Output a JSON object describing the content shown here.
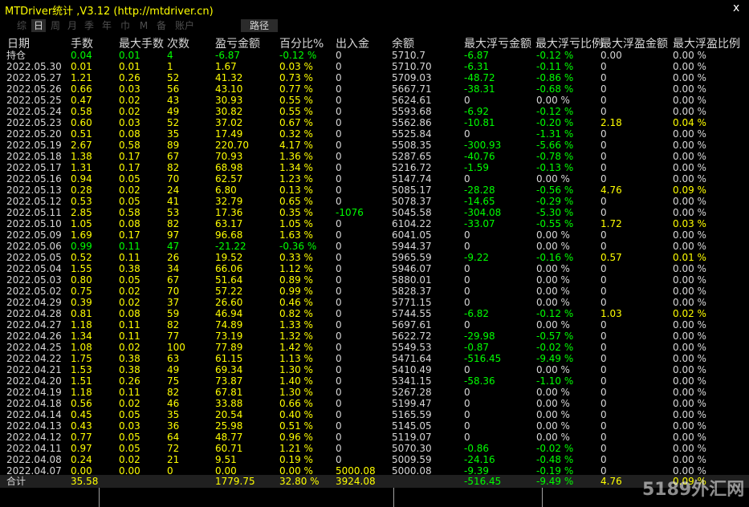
{
  "window": {
    "title": "MTDriver统计 ,V3.12 (http://mtdriver.cn)",
    "close_label": "x"
  },
  "tabs": [
    {
      "label": "综"
    },
    {
      "label": "日"
    },
    {
      "label": "周"
    },
    {
      "label": "月"
    },
    {
      "label": "季"
    },
    {
      "label": "年"
    },
    {
      "label": "巾"
    },
    {
      "label": "M"
    },
    {
      "label": "备"
    },
    {
      "label": "账户"
    },
    {
      "label": "路径"
    }
  ],
  "active_tab": "日",
  "headers": [
    "日期",
    "手数",
    "最大手数",
    "次数",
    "盈亏金额",
    "百分比%",
    "出入金",
    "余额",
    "最大浮亏金额",
    "最大浮亏比例",
    "最大浮盈金额",
    "最大浮盈比例"
  ],
  "rows": [
    {
      "date": "持仓",
      "lots": "0.04",
      "max_lots": "0.01",
      "count": "4",
      "pnl": "-6.87",
      "pct": "-0.12 %",
      "flow": "0",
      "balance": "5710.7",
      "max_loss": "-6.87",
      "max_loss_pct": "-0.12 %",
      "max_gain": "0.00",
      "max_gain_pct": "0.00 %",
      "color": "g"
    },
    {
      "date": "2022.05.30",
      "lots": "0.01",
      "max_lots": "0.01",
      "count": "1",
      "pnl": "1.67",
      "pct": "0.03 %",
      "flow": "0",
      "balance": "5710.70",
      "max_loss": "-6.31",
      "max_loss_pct": "-0.11 %",
      "max_gain": "0",
      "max_gain_pct": "0.00 %",
      "color": "y"
    },
    {
      "date": "2022.05.27",
      "lots": "1.21",
      "max_lots": "0.26",
      "count": "52",
      "pnl": "41.32",
      "pct": "0.73 %",
      "flow": "0",
      "balance": "5709.03",
      "max_loss": "-48.72",
      "max_loss_pct": "-0.86 %",
      "max_gain": "0",
      "max_gain_pct": "0.00 %",
      "color": "y"
    },
    {
      "date": "2022.05.26",
      "lots": "0.66",
      "max_lots": "0.03",
      "count": "56",
      "pnl": "43.10",
      "pct": "0.77 %",
      "flow": "0",
      "balance": "5667.71",
      "max_loss": "-38.31",
      "max_loss_pct": "-0.68 %",
      "max_gain": "0",
      "max_gain_pct": "0.00 %",
      "color": "y"
    },
    {
      "date": "2022.05.25",
      "lots": "0.47",
      "max_lots": "0.02",
      "count": "43",
      "pnl": "30.93",
      "pct": "0.55 %",
      "flow": "0",
      "balance": "5624.61",
      "max_loss": "0",
      "max_loss_pct": "0.00 %",
      "max_gain": "0",
      "max_gain_pct": "0.00 %",
      "color": "y"
    },
    {
      "date": "2022.05.24",
      "lots": "0.58",
      "max_lots": "0.02",
      "count": "49",
      "pnl": "30.82",
      "pct": "0.55 %",
      "flow": "0",
      "balance": "5593.68",
      "max_loss": "-6.92",
      "max_loss_pct": "-0.12 %",
      "max_gain": "0",
      "max_gain_pct": "0.00 %",
      "color": "y"
    },
    {
      "date": "2022.05.23",
      "lots": "0.60",
      "max_lots": "0.03",
      "count": "52",
      "pnl": "37.02",
      "pct": "0.67 %",
      "flow": "0",
      "balance": "5562.86",
      "max_loss": "-10.81",
      "max_loss_pct": "-0.20 %",
      "max_gain": "2.18",
      "max_gain_pct": "0.04 %",
      "color": "y"
    },
    {
      "date": "2022.05.20",
      "lots": "0.51",
      "max_lots": "0.08",
      "count": "35",
      "pnl": "17.49",
      "pct": "0.32 %",
      "flow": "0",
      "balance": "5525.84",
      "max_loss": "0",
      "max_loss_pct": "-1.31 %",
      "max_gain": "0",
      "max_gain_pct": "0.00 %",
      "color": "y"
    },
    {
      "date": "2022.05.19",
      "lots": "2.67",
      "max_lots": "0.58",
      "count": "89",
      "pnl": "220.70",
      "pct": "4.17 %",
      "flow": "0",
      "balance": "5508.35",
      "max_loss": "-300.93",
      "max_loss_pct": "-5.66 %",
      "max_gain": "0",
      "max_gain_pct": "0.00 %",
      "color": "y"
    },
    {
      "date": "2022.05.18",
      "lots": "1.38",
      "max_lots": "0.17",
      "count": "67",
      "pnl": "70.93",
      "pct": "1.36 %",
      "flow": "0",
      "balance": "5287.65",
      "max_loss": "-40.76",
      "max_loss_pct": "-0.78 %",
      "max_gain": "0",
      "max_gain_pct": "0.00 %",
      "color": "y"
    },
    {
      "date": "2022.05.17",
      "lots": "1.31",
      "max_lots": "0.17",
      "count": "82",
      "pnl": "68.98",
      "pct": "1.34 %",
      "flow": "0",
      "balance": "5216.72",
      "max_loss": "-1.59",
      "max_loss_pct": "-0.13 %",
      "max_gain": "0",
      "max_gain_pct": "0.00 %",
      "color": "y"
    },
    {
      "date": "2022.05.16",
      "lots": "0.94",
      "max_lots": "0.05",
      "count": "70",
      "pnl": "62.57",
      "pct": "1.23 %",
      "flow": "0",
      "balance": "5147.74",
      "max_loss": "0",
      "max_loss_pct": "0.00 %",
      "max_gain": "0",
      "max_gain_pct": "0.00 %",
      "color": "y"
    },
    {
      "date": "2022.05.13",
      "lots": "0.28",
      "max_lots": "0.02",
      "count": "24",
      "pnl": "6.80",
      "pct": "0.13 %",
      "flow": "0",
      "balance": "5085.17",
      "max_loss": "-28.28",
      "max_loss_pct": "-0.56 %",
      "max_gain": "4.76",
      "max_gain_pct": "0.09 %",
      "color": "y"
    },
    {
      "date": "2022.05.12",
      "lots": "0.53",
      "max_lots": "0.05",
      "count": "41",
      "pnl": "32.79",
      "pct": "0.65 %",
      "flow": "0",
      "balance": "5078.37",
      "max_loss": "-14.65",
      "max_loss_pct": "-0.29 %",
      "max_gain": "0",
      "max_gain_pct": "0.00 %",
      "color": "y"
    },
    {
      "date": "2022.05.11",
      "lots": "2.85",
      "max_lots": "0.58",
      "count": "53",
      "pnl": "17.36",
      "pct": "0.35 %",
      "flow": "-1076",
      "balance": "5045.58",
      "max_loss": "-304.08",
      "max_loss_pct": "-5.30 %",
      "max_gain": "0",
      "max_gain_pct": "0.00 %",
      "color": "y"
    },
    {
      "date": "2022.05.10",
      "lots": "1.05",
      "max_lots": "0.08",
      "count": "82",
      "pnl": "63.17",
      "pct": "1.05 %",
      "flow": "0",
      "balance": "6104.22",
      "max_loss": "-33.07",
      "max_loss_pct": "-0.55 %",
      "max_gain": "1.72",
      "max_gain_pct": "0.03 %",
      "color": "y"
    },
    {
      "date": "2022.05.09",
      "lots": "1.69",
      "max_lots": "0.17",
      "count": "97",
      "pnl": "96.68",
      "pct": "1.63 %",
      "flow": "0",
      "balance": "6041.05",
      "max_loss": "0",
      "max_loss_pct": "0.00 %",
      "max_gain": "0",
      "max_gain_pct": "0.00 %",
      "color": "y"
    },
    {
      "date": "2022.05.06",
      "lots": "0.99",
      "max_lots": "0.11",
      "count": "47",
      "pnl": "-21.22",
      "pct": "-0.36 %",
      "flow": "0",
      "balance": "5944.37",
      "max_loss": "0",
      "max_loss_pct": "0.00 %",
      "max_gain": "0",
      "max_gain_pct": "0.00 %",
      "color": "g"
    },
    {
      "date": "2022.05.05",
      "lots": "0.52",
      "max_lots": "0.11",
      "count": "26",
      "pnl": "19.52",
      "pct": "0.33 %",
      "flow": "0",
      "balance": "5965.59",
      "max_loss": "-9.22",
      "max_loss_pct": "-0.16 %",
      "max_gain": "0.57",
      "max_gain_pct": "0.01 %",
      "color": "y"
    },
    {
      "date": "2022.05.04",
      "lots": "1.55",
      "max_lots": "0.38",
      "count": "34",
      "pnl": "66.06",
      "pct": "1.12 %",
      "flow": "0",
      "balance": "5946.07",
      "max_loss": "0",
      "max_loss_pct": "0.00 %",
      "max_gain": "0",
      "max_gain_pct": "0.00 %",
      "color": "y"
    },
    {
      "date": "2022.05.03",
      "lots": "0.80",
      "max_lots": "0.05",
      "count": "67",
      "pnl": "51.64",
      "pct": "0.89 %",
      "flow": "0",
      "balance": "5880.01",
      "max_loss": "0",
      "max_loss_pct": "0.00 %",
      "max_gain": "0",
      "max_gain_pct": "0.00 %",
      "color": "y"
    },
    {
      "date": "2022.05.02",
      "lots": "0.75",
      "max_lots": "0.02",
      "count": "70",
      "pnl": "57.22",
      "pct": "0.99 %",
      "flow": "0",
      "balance": "5828.37",
      "max_loss": "0",
      "max_loss_pct": "0.00 %",
      "max_gain": "0",
      "max_gain_pct": "0.00 %",
      "color": "y"
    },
    {
      "date": "2022.04.29",
      "lots": "0.39",
      "max_lots": "0.02",
      "count": "37",
      "pnl": "26.60",
      "pct": "0.46 %",
      "flow": "0",
      "balance": "5771.15",
      "max_loss": "0",
      "max_loss_pct": "0.00 %",
      "max_gain": "0",
      "max_gain_pct": "0.00 %",
      "color": "y"
    },
    {
      "date": "2022.04.28",
      "lots": "0.81",
      "max_lots": "0.08",
      "count": "59",
      "pnl": "46.94",
      "pct": "0.82 %",
      "flow": "0",
      "balance": "5744.55",
      "max_loss": "-6.82",
      "max_loss_pct": "-0.12 %",
      "max_gain": "1.03",
      "max_gain_pct": "0.02 %",
      "color": "y"
    },
    {
      "date": "2022.04.27",
      "lots": "1.18",
      "max_lots": "0.11",
      "count": "82",
      "pnl": "74.89",
      "pct": "1.33 %",
      "flow": "0",
      "balance": "5697.61",
      "max_loss": "0",
      "max_loss_pct": "0.00 %",
      "max_gain": "0",
      "max_gain_pct": "0.00 %",
      "color": "y"
    },
    {
      "date": "2022.04.26",
      "lots": "1.34",
      "max_lots": "0.11",
      "count": "77",
      "pnl": "73.19",
      "pct": "1.32 %",
      "flow": "0",
      "balance": "5622.72",
      "max_loss": "-29.98",
      "max_loss_pct": "-0.57 %",
      "max_gain": "0",
      "max_gain_pct": "0.00 %",
      "color": "y"
    },
    {
      "date": "2022.04.25",
      "lots": "1.08",
      "max_lots": "0.02",
      "count": "100",
      "pnl": "77.89",
      "pct": "1.42 %",
      "flow": "0",
      "balance": "5549.53",
      "max_loss": "-0.87",
      "max_loss_pct": "-0.02 %",
      "max_gain": "0",
      "max_gain_pct": "0.00 %",
      "color": "y"
    },
    {
      "date": "2022.04.22",
      "lots": "1.75",
      "max_lots": "0.38",
      "count": "63",
      "pnl": "61.15",
      "pct": "1.13 %",
      "flow": "0",
      "balance": "5471.64",
      "max_loss": "-516.45",
      "max_loss_pct": "-9.49 %",
      "max_gain": "0",
      "max_gain_pct": "0.00 %",
      "color": "y"
    },
    {
      "date": "2022.04.21",
      "lots": "1.53",
      "max_lots": "0.38",
      "count": "49",
      "pnl": "69.34",
      "pct": "1.30 %",
      "flow": "0",
      "balance": "5410.49",
      "max_loss": "0",
      "max_loss_pct": "0.00 %",
      "max_gain": "0",
      "max_gain_pct": "0.00 %",
      "color": "y"
    },
    {
      "date": "2022.04.20",
      "lots": "1.51",
      "max_lots": "0.26",
      "count": "75",
      "pnl": "73.87",
      "pct": "1.40 %",
      "flow": "0",
      "balance": "5341.15",
      "max_loss": "-58.36",
      "max_loss_pct": "-1.10 %",
      "max_gain": "0",
      "max_gain_pct": "0.00 %",
      "color": "y"
    },
    {
      "date": "2022.04.19",
      "lots": "1.18",
      "max_lots": "0.11",
      "count": "82",
      "pnl": "67.81",
      "pct": "1.30 %",
      "flow": "0",
      "balance": "5267.28",
      "max_loss": "0",
      "max_loss_pct": "0.00 %",
      "max_gain": "0",
      "max_gain_pct": "0.00 %",
      "color": "y"
    },
    {
      "date": "2022.04.18",
      "lots": "0.56",
      "max_lots": "0.02",
      "count": "46",
      "pnl": "33.88",
      "pct": "0.66 %",
      "flow": "0",
      "balance": "5199.47",
      "max_loss": "0",
      "max_loss_pct": "0.00 %",
      "max_gain": "0",
      "max_gain_pct": "0.00 %",
      "color": "y"
    },
    {
      "date": "2022.04.14",
      "lots": "0.45",
      "max_lots": "0.05",
      "count": "35",
      "pnl": "20.54",
      "pct": "0.40 %",
      "flow": "0",
      "balance": "5165.59",
      "max_loss": "0",
      "max_loss_pct": "0.00 %",
      "max_gain": "0",
      "max_gain_pct": "0.00 %",
      "color": "y"
    },
    {
      "date": "2022.04.13",
      "lots": "0.43",
      "max_lots": "0.03",
      "count": "36",
      "pnl": "25.98",
      "pct": "0.51 %",
      "flow": "0",
      "balance": "5145.05",
      "max_loss": "0",
      "max_loss_pct": "0.00 %",
      "max_gain": "0",
      "max_gain_pct": "0.00 %",
      "color": "y"
    },
    {
      "date": "2022.04.12",
      "lots": "0.77",
      "max_lots": "0.05",
      "count": "64",
      "pnl": "48.77",
      "pct": "0.96 %",
      "flow": "0",
      "balance": "5119.07",
      "max_loss": "0",
      "max_loss_pct": "0.00 %",
      "max_gain": "0",
      "max_gain_pct": "0.00 %",
      "color": "y"
    },
    {
      "date": "2022.04.11",
      "lots": "0.97",
      "max_lots": "0.05",
      "count": "72",
      "pnl": "60.71",
      "pct": "1.21 %",
      "flow": "0",
      "balance": "5070.30",
      "max_loss": "-0.86",
      "max_loss_pct": "-0.02 %",
      "max_gain": "0",
      "max_gain_pct": "0.00 %",
      "color": "y"
    },
    {
      "date": "2022.04.08",
      "lots": "0.24",
      "max_lots": "0.02",
      "count": "21",
      "pnl": "9.51",
      "pct": "0.19 %",
      "flow": "0",
      "balance": "5009.59",
      "max_loss": "-24.16",
      "max_loss_pct": "-0.48 %",
      "max_gain": "0",
      "max_gain_pct": "0.00 %",
      "color": "y"
    },
    {
      "date": "2022.04.07",
      "lots": "0.00",
      "max_lots": "0.00",
      "count": "0",
      "pnl": "0.00",
      "pct": "0.00 %",
      "flow": "5000.08",
      "balance": "5000.08",
      "max_loss": "-9.39",
      "max_loss_pct": "-0.19 %",
      "max_gain": "0",
      "max_gain_pct": "0.00 %",
      "color": "y"
    }
  ],
  "total": {
    "label": "合计",
    "lots": "35.58",
    "pnl": "1779.75",
    "pct": "32.80 %",
    "flow": "3924.08",
    "max_loss": "-516.45",
    "max_loss_pct": "-9.49 %",
    "max_gain": "4.76",
    "max_gain_pct": "0.09 %"
  },
  "watermark": "5189外汇网",
  "colors": {
    "yellow": "#ffff00",
    "green": "#00ff00",
    "gray": "#d7d7d7",
    "background": "#000000"
  }
}
